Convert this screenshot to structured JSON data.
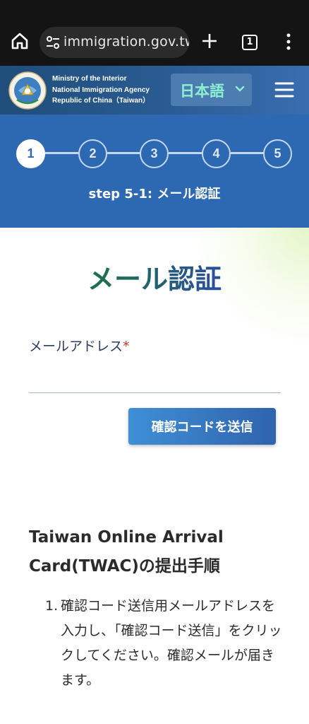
{
  "browser": {
    "url": "immigration.gov.tw",
    "tab_count": "1"
  },
  "header": {
    "agency_line1": "Ministry of the Interior",
    "agency_line2": "National Immigration Agency",
    "agency_line3": "Republic of China（Taiwan）",
    "language": "日本語",
    "colors": {
      "bar": "#2a5b93",
      "language_text": "#8ef0d2"
    }
  },
  "stepper": {
    "steps": [
      "1",
      "2",
      "3",
      "4",
      "5"
    ],
    "current_step": 1,
    "caption": "step 5-1: メール認証"
  },
  "main": {
    "title": "メール認証",
    "email_label": "メールアドレス",
    "required_mark": "*",
    "email_value": "",
    "send_button": "確認コードを送信",
    "section_title": "Taiwan Online Arrival Card(TWAC)の提出手順",
    "instructions": [
      {
        "number": "1.",
        "text": "確認コード送信用メールアドレスを入力し、「確認コード送信」をクリックしてください。確認メールが届きます。"
      }
    ]
  }
}
